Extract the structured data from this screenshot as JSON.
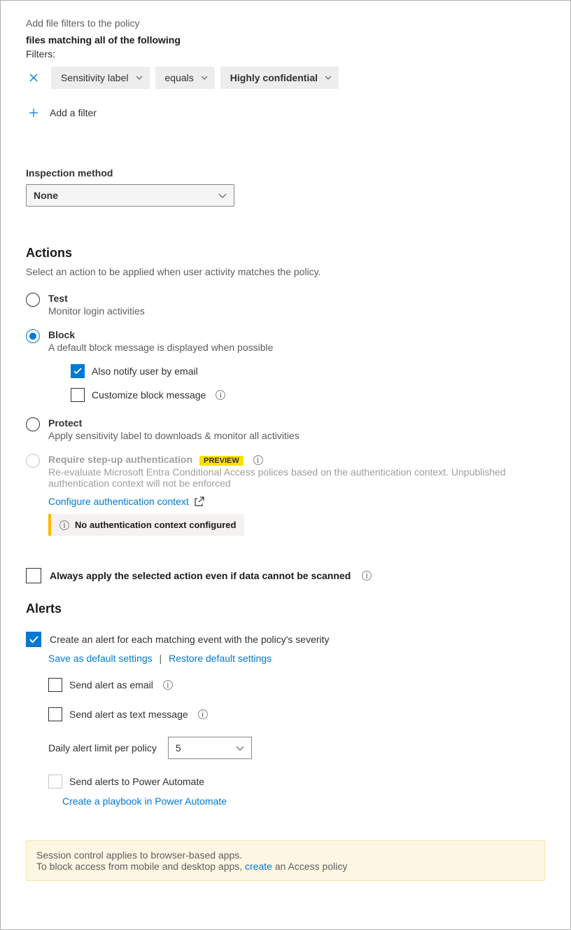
{
  "header": {
    "subtitle": "Add file filters to the policy",
    "matching": "files matching all of the following",
    "filters_label": "Filters:"
  },
  "filter": {
    "field": "Sensitivity label",
    "operator": "equals",
    "value": "Highly confidential",
    "add_label": "Add a filter"
  },
  "inspection": {
    "label": "Inspection method",
    "value": "None"
  },
  "actions": {
    "title": "Actions",
    "description": "Select an action to be applied when user activity matches the policy.",
    "test": {
      "title": "Test",
      "desc": "Monitor login activities"
    },
    "block": {
      "title": "Block",
      "desc": "A default block message is displayed when possible",
      "notify_label": "Also notify user by email",
      "customize_label": "Customize block message"
    },
    "protect": {
      "title": "Protect",
      "desc": "Apply sensitivity label to downloads & monitor all activities"
    },
    "stepup": {
      "title": "Require step-up authentication",
      "preview": "PREVIEW",
      "desc": "Re-evaluate Microsoft Entra Conditional Access polices based on the authentication context. Unpublished authentication context will not be enforced",
      "configure": "Configure authentication context",
      "warn": "No authentication context configured"
    },
    "always_label": "Always apply the selected action even if data cannot be scanned"
  },
  "alerts": {
    "title": "Alerts",
    "create_label": "Create an alert for each matching event with the policy's severity",
    "save_link": "Save as default settings",
    "restore_link": "Restore default settings",
    "email_label": "Send alert as email",
    "sms_label": "Send alert as text message",
    "daily_label": "Daily alert limit per policy",
    "daily_value": "5",
    "pa_label": "Send alerts to Power Automate",
    "pa_link": "Create a playbook in Power Automate"
  },
  "footer": {
    "line1": "Session control applies to browser-based apps.",
    "line2a": "To block access from mobile and desktop apps, ",
    "line2_link": "create",
    "line2b": " an Access policy"
  }
}
